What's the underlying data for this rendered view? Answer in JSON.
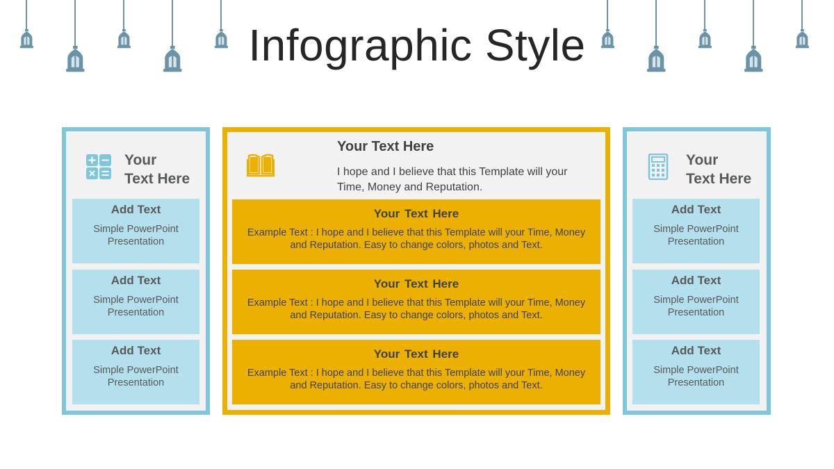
{
  "slide": {
    "title": "Infographic Style"
  },
  "colors": {
    "blue_border": "#7ec6dc",
    "blue_fill": "#b4dfec",
    "gold": "#ecb100",
    "lantern": "#6a93a8",
    "panel_bg": "#f2f2f2"
  },
  "left_panel": {
    "icon": "calculator-keys-icon",
    "heading_line1": "Your",
    "heading_line2": "Text Here",
    "items": [
      {
        "title": "Add Text",
        "subtitle": "Simple PowerPoint Presentation"
      },
      {
        "title": "Add Text",
        "subtitle": "Simple PowerPoint Presentation"
      },
      {
        "title": "Add Text",
        "subtitle": "Simple PowerPoint Presentation"
      }
    ]
  },
  "center_panel": {
    "icon": "open-book-icon",
    "heading": "Your Text Here",
    "description": "I hope and I believe that this Template will your Time, Money and Reputation.",
    "items": [
      {
        "title": "Your Text Here",
        "text": "Example Text : I hope and I believe that this Template will your Time, Money and Reputation. Easy to change colors, photos and Text."
      },
      {
        "title": "Your Text Here",
        "text": "Example Text : I hope and I believe that this Template will your Time, Money and Reputation. Easy to change colors, photos and Text."
      },
      {
        "title": "Your Text Here",
        "text": "Example Text : I hope and I believe that this Template will your Time, Money and Reputation. Easy to change colors, photos and Text."
      }
    ]
  },
  "right_panel": {
    "icon": "calculator-icon",
    "heading_line1": "Your",
    "heading_line2": "Text Here",
    "items": [
      {
        "title": "Add Text",
        "subtitle": "Simple PowerPoint Presentation"
      },
      {
        "title": "Add Text",
        "subtitle": "Simple PowerPoint Presentation"
      },
      {
        "title": "Add Text",
        "subtitle": "Simple PowerPoint Presentation"
      }
    ]
  },
  "decorations": {
    "lantern_icon": "hanging-lantern-icon"
  }
}
